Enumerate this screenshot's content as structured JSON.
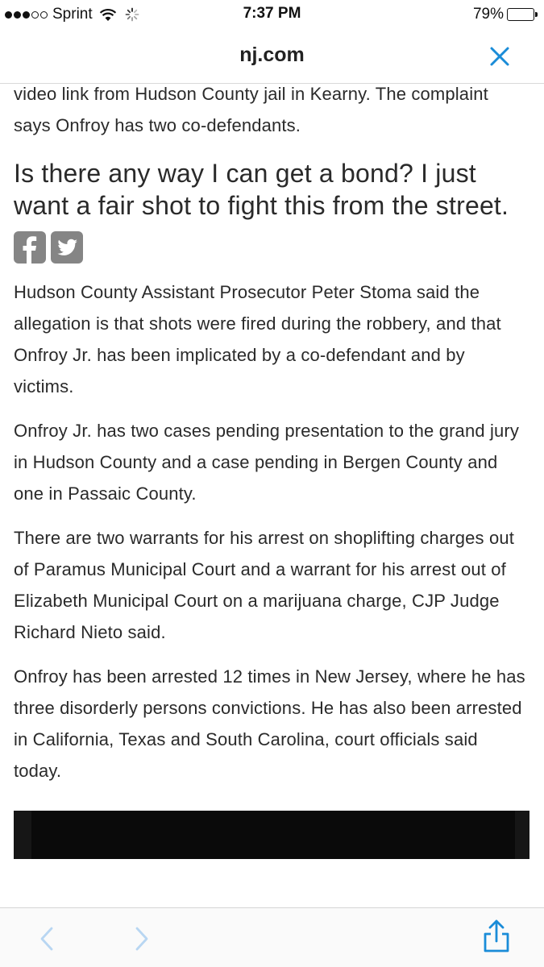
{
  "status_bar": {
    "carrier": "Sprint",
    "time": "7:37 PM",
    "battery": "79%",
    "battery_level": 0.79,
    "signal_bars_filled": 3,
    "signal_bars_total": 5
  },
  "address_bar": {
    "site": "nj.com",
    "close_icon": "close-icon",
    "accent_color": "#1a8cd8"
  },
  "article": {
    "intro_text": "video link from Hudson County jail in Kearny. The complaint says Onfroy has two co-defendants.",
    "pull_quote": "Is there any way I can get a bond? I just want a fair shot to fight this from the street.",
    "share_icons": [
      "facebook-icon",
      "twitter-icon"
    ],
    "paragraphs": [
      "Hudson County Assistant Prosecutor Peter Stoma said the allegation is that shots were fired during the robbery, and that Onfroy Jr. has been implicated by a co-defendant and by victims.",
      "Onfroy Jr. has two cases pending presentation to the grand jury in Hudson County and a case pending in Bergen County and one in Passaic County.",
      "There are two warrants for his arrest on shoplifting charges out of Paramus Municipal Court and a warrant for his arrest out of Elizabeth Municipal Court on a marijuana charge, CJP Judge Richard Nieto said.",
      "Onfroy has been arrested 12 times in New Jersey, where he has three disorderly persons convictions. He has also been arrested in California, Texas and South Carolina, court officials said today."
    ]
  },
  "toolbar": {
    "icons": [
      "back-icon",
      "forward-icon",
      "share-icon"
    ],
    "accent_color": "#1a8cd8",
    "disabled_color": "#b8d6f2"
  }
}
